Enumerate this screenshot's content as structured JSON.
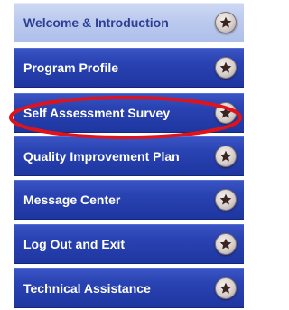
{
  "nav": {
    "items": [
      {
        "label": "Welcome & Introduction",
        "icon": "star-icon",
        "active": true
      },
      {
        "label": "Program Profile",
        "icon": "star-icon",
        "active": false
      },
      {
        "label": "Self Assessment Survey",
        "icon": "star-icon",
        "active": false
      },
      {
        "label": "Quality Improvement Plan",
        "icon": "star-icon",
        "active": false
      },
      {
        "label": "Message Center",
        "icon": "star-icon",
        "active": false
      },
      {
        "label": "Log Out and Exit",
        "icon": "star-icon",
        "active": false
      },
      {
        "label": "Technical Assistance",
        "icon": "star-icon",
        "active": false
      }
    ]
  },
  "colors": {
    "nav_blue": "#2a43b3",
    "nav_active": "#bccaee",
    "active_text": "#2e3f95",
    "highlight_red": "#e0131b",
    "star": "#3a2420"
  }
}
